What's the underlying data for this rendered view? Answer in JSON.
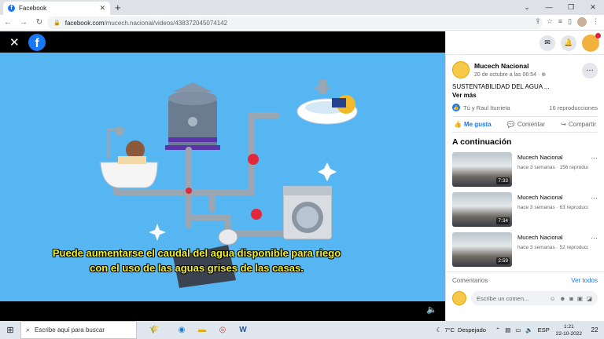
{
  "browser": {
    "tab_title": "Facebook",
    "tab_favicon": "f",
    "url_host": "facebook.com",
    "url_path": "/mucech.nacional/videos/438372045074142",
    "new_tab": "+",
    "back": "←",
    "forward": "→",
    "reload": "↻"
  },
  "video": {
    "close": "✕",
    "logo": "f",
    "subtitle_line1": "Puede aumentarse el caudal del agua disponible para riego",
    "subtitle_line2": "con el uso de las aguas grises de las casas.",
    "volume": "🔈"
  },
  "post": {
    "author": "Mucech Nacional",
    "date": "20 de octubre a las 06:54 · ⊕",
    "title": "SUSTENTABILIDAD DEL AGUA ...",
    "see_more": "Ver más",
    "reactions": "Tú y Raul Iturrieta",
    "views": "16 reproducciones",
    "like": "Me gusta",
    "comment": "Comentar",
    "share": "Compartir"
  },
  "next": {
    "heading": "A continuación",
    "items": [
      {
        "title": "Mucech Nacional",
        "meta": "hace 3 semanas · 156 reproducciones",
        "duration": "7:33"
      },
      {
        "title": "Mucech Nacional",
        "meta": "hace 3 semanas · 63 reproducciones",
        "duration": "7:34"
      },
      {
        "title": "Mucech Nacional",
        "meta": "hace 3 semanas · 52 reproducciones",
        "duration": "2:59"
      }
    ]
  },
  "comments": {
    "label": "Comentarios",
    "see_all": "Ver todos",
    "placeholder": "Escribe un comen..."
  },
  "taskbar": {
    "search": "Escribe aquí para buscar",
    "weather_temp": "7°C",
    "weather_desc": "Despejado",
    "lang": "ESP",
    "time": "1:21",
    "date": "22-10-2022",
    "notifications": "22"
  },
  "colors": {
    "fb_blue": "#1877f2",
    "video_bg": "#55b6f2",
    "subtitle": "#f3f02a"
  }
}
